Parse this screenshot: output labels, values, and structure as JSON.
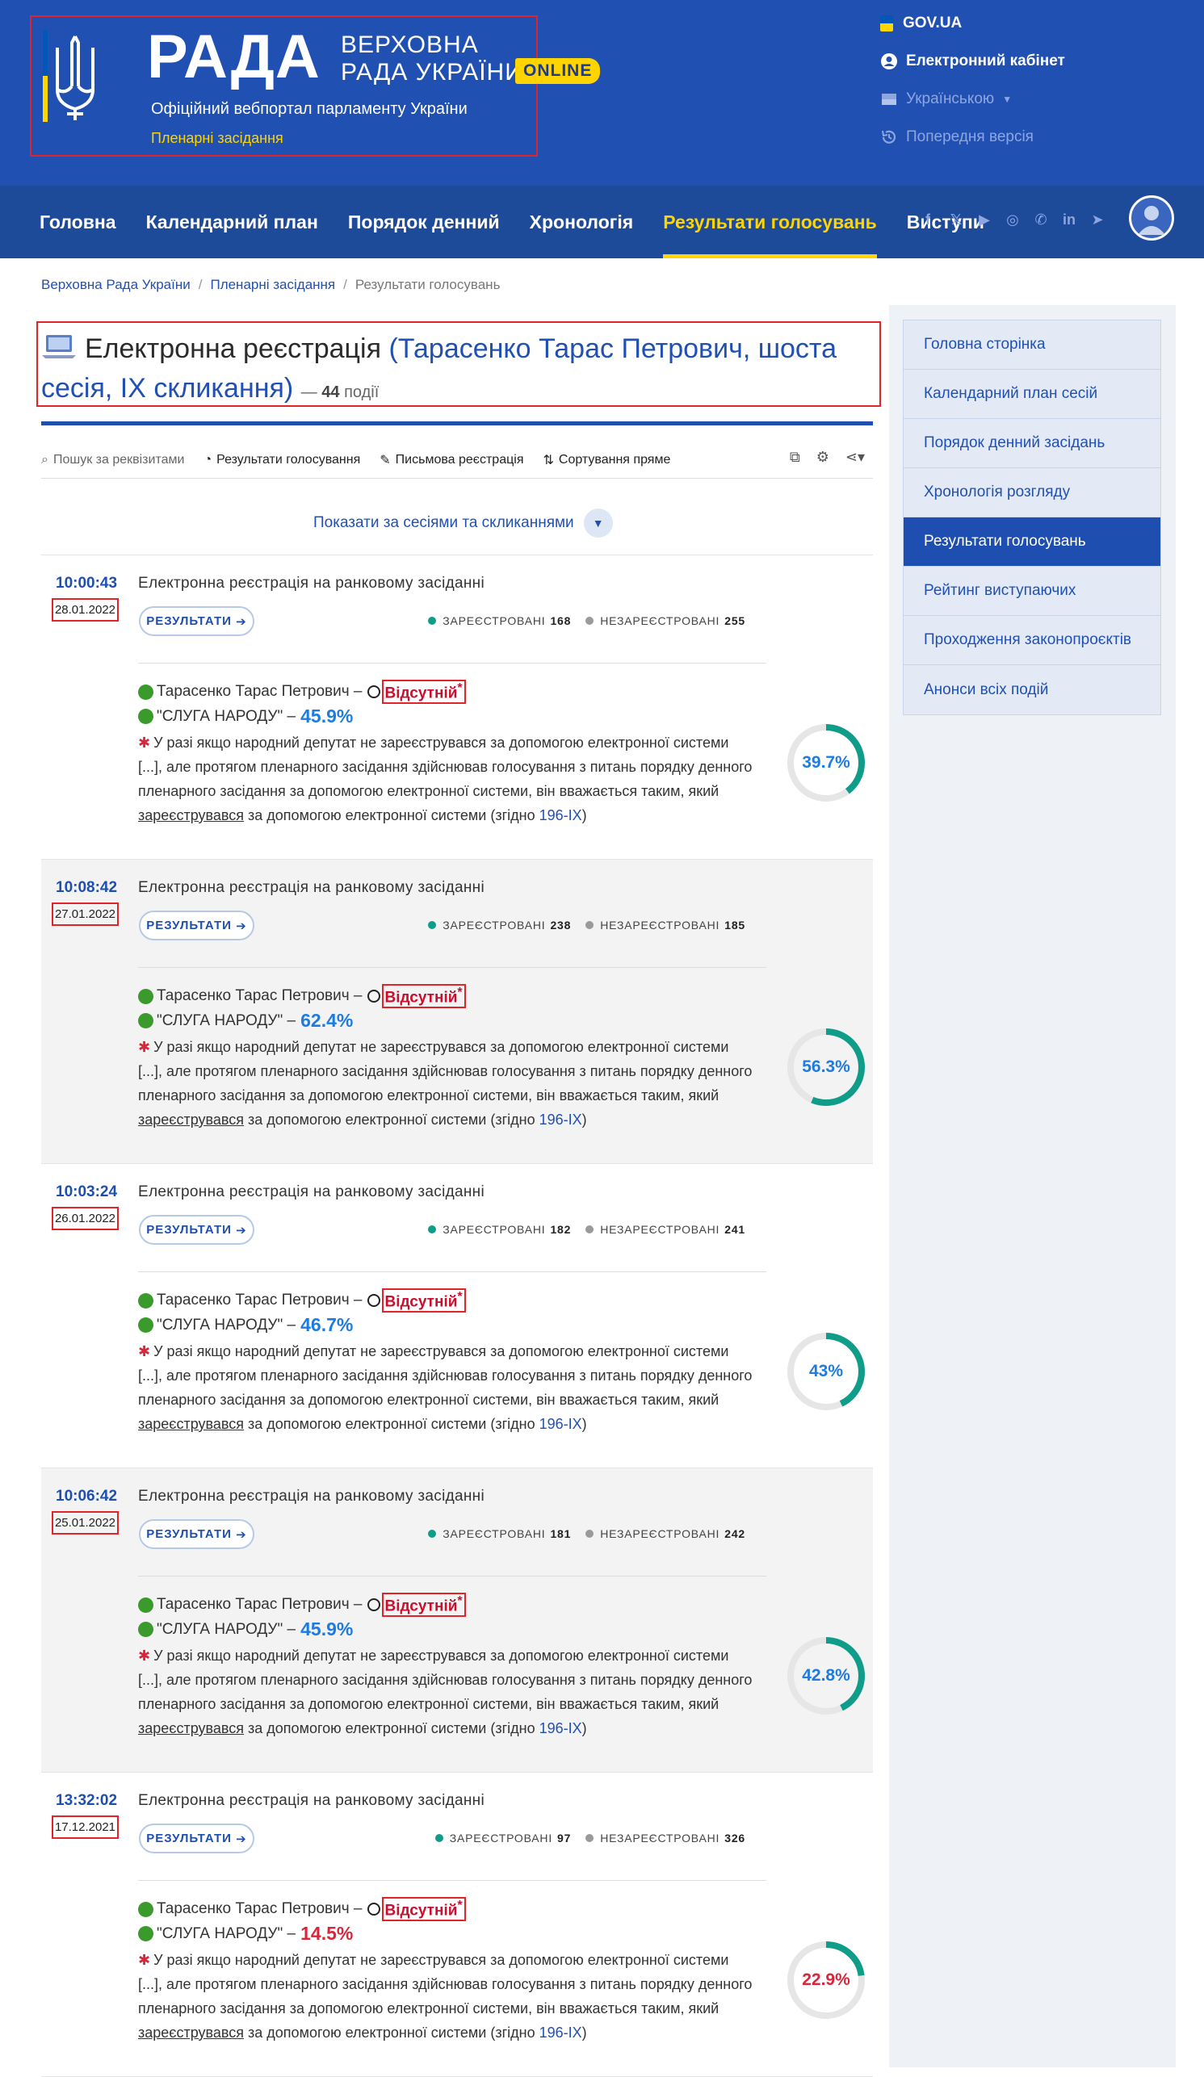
{
  "header": {
    "brand_word": "РАДА",
    "brand_sub_line1": "ВЕРХОВНА",
    "brand_sub_line2": "РАДА УКРАЇНИ",
    "online_badge": "ONLINE",
    "portal_subtitle": "Офіційний вебпортал парламенту України",
    "plenary_subtitle": "Пленарні засідання",
    "gov_link": "GOV.UA",
    "cabinet_link": "Електронний кабінет",
    "language": "Українською",
    "prev_version": "Попередня версія",
    "flag_colors": [
      "#0057b7",
      "#ffd700"
    ]
  },
  "nav": {
    "items": [
      {
        "label": "Головна"
      },
      {
        "label": "Календарний план"
      },
      {
        "label": "Порядок денний"
      },
      {
        "label": "Хронологія"
      },
      {
        "label": "Результати голосувань"
      },
      {
        "label": "Виступи"
      }
    ],
    "active_index": 4,
    "socials": [
      "facebook-icon",
      "x-icon",
      "youtube-icon",
      "instagram-icon",
      "whatsapp-icon",
      "linkedin-icon",
      "telegram-icon"
    ]
  },
  "breadcrumb": {
    "items": [
      "Верховна Рада України",
      "Пленарні засідання",
      "Результати голосувань"
    ]
  },
  "page": {
    "title_prefix": "Електронна реєстрація",
    "title_link": "(Тарасенко Тарас Петрович, шоста сесія, IX скликання)",
    "count_dash": "—",
    "count_value": "44",
    "count_suffix": "події"
  },
  "toolbar": {
    "search": "Пошук за реквізитами",
    "results": "Результати голосування",
    "written": "Письмова реєстрація",
    "sort": "Сортування пряме"
  },
  "show_sessions": "Показати за сесіями та скликаннями",
  "sidebar": {
    "items": [
      {
        "label": "Головна сторінка"
      },
      {
        "label": "Календарний план сесій"
      },
      {
        "label": "Порядок денний засідань"
      },
      {
        "label": "Хронологія розгляду"
      },
      {
        "label": "Результати голосувань"
      },
      {
        "label": "Рейтинг виступаючих"
      },
      {
        "label": "Проходження законопроєктів"
      },
      {
        "label": "Анонси всіх подій"
      }
    ],
    "active_index": 4
  },
  "event_labels": {
    "results_btn": "РЕЗУЛЬТАТИ",
    "registered": "ЗАРЕЄСТРОВАНІ",
    "unregistered": "НЕЗАРЕЄСТРОВАНІ",
    "deputy": "Тарасенко Тарас Петрович –",
    "absent": "Відсутній",
    "absent_mark": "*",
    "party": "\"СЛУГА НАРОДУ\" –",
    "note_line1": "У разі якщо народний депутат не зареєструвався за допомогою електронної системи",
    "note_line2": "[...], але протягом пленарного засідання здійснював голосування з питань порядку денного",
    "note_line3": "пленарного засідання за допомогою електронної системи, він вважається таким, який",
    "note_u": "зареєструвався",
    "note_tail": "за допомогою електронної системи (згідно",
    "law_link": "196-IX",
    "note_close": ")"
  },
  "colors": {
    "accent": "#2150b3",
    "gauge_teal": "#0f9d8a",
    "gauge_red": "#d9263a",
    "pct_blue": "#1e7be0",
    "pct_red": "#d9263a",
    "registered_dot": "#0f9d8a",
    "unregistered_dot": "#9a9a9a"
  },
  "events": [
    {
      "time": "10:00:43",
      "date": "28.01.2022",
      "title": "Електронна реєстрація на ранковому засіданні",
      "registered": "168",
      "unregistered": "255",
      "party_pct": "45.9%",
      "party_pct_color": "#1e7be0",
      "gauge_label": "39.7%",
      "gauge_value": 39.7,
      "gauge_color": "#0f9d8a",
      "gauge_text_color": "#1e7be0"
    },
    {
      "time": "10:08:42",
      "date": "27.01.2022",
      "title": "Електронна реєстрація на ранковому засіданні",
      "registered": "238",
      "unregistered": "185",
      "party_pct": "62.4%",
      "party_pct_color": "#1e7be0",
      "gauge_label": "56.3%",
      "gauge_value": 56.3,
      "gauge_color": "#0f9d8a",
      "gauge_text_color": "#1e7be0"
    },
    {
      "time": "10:03:24",
      "date": "26.01.2022",
      "title": "Електронна реєстрація на ранковому засіданні",
      "registered": "182",
      "unregistered": "241",
      "party_pct": "46.7%",
      "party_pct_color": "#1e7be0",
      "gauge_label": "43%",
      "gauge_value": 43,
      "gauge_color": "#0f9d8a",
      "gauge_text_color": "#1e7be0"
    },
    {
      "time": "10:06:42",
      "date": "25.01.2022",
      "title": "Електронна реєстрація на ранковому засіданні",
      "registered": "181",
      "unregistered": "242",
      "party_pct": "45.9%",
      "party_pct_color": "#1e7be0",
      "gauge_label": "42.8%",
      "gauge_value": 42.8,
      "gauge_color": "#0f9d8a",
      "gauge_text_color": "#1e7be0"
    },
    {
      "time": "13:32:02",
      "date": "17.12.2021",
      "title": "Електронна реєстрація на ранковому засіданні",
      "registered": "97",
      "unregistered": "326",
      "party_pct": "14.5%",
      "party_pct_color": "#d9263a",
      "gauge_label": "22.9%",
      "gauge_value": 22.9,
      "gauge_color": "#0f9d8a",
      "gauge_text_color": "#d9263a"
    }
  ]
}
